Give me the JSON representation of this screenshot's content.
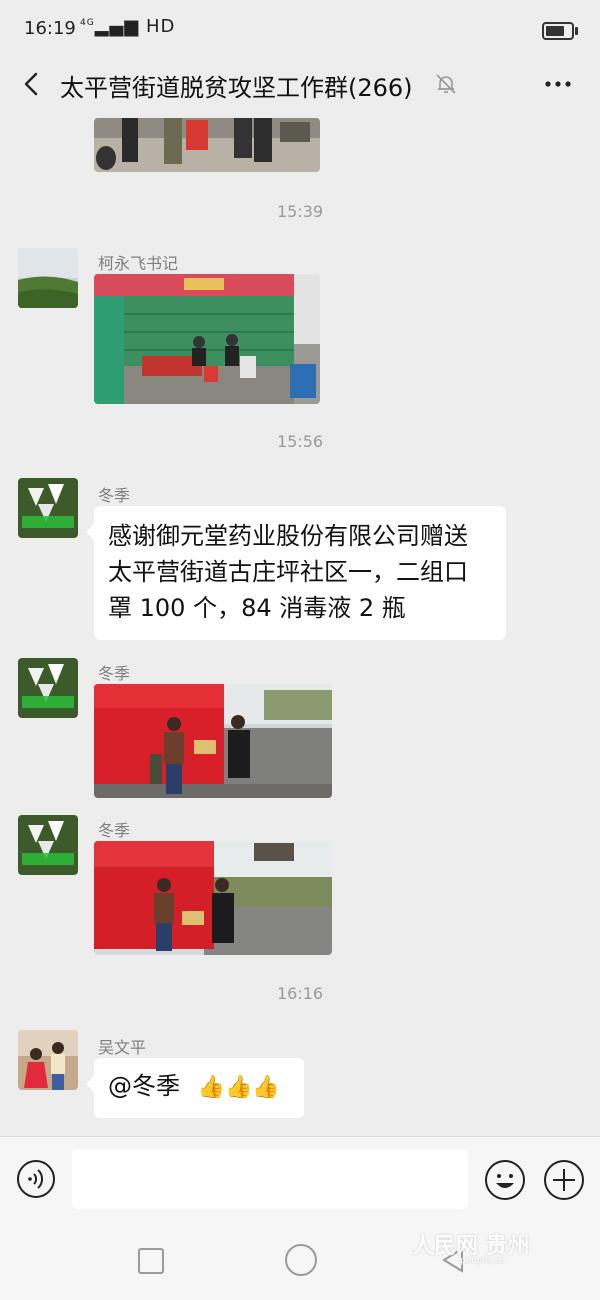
{
  "status_bar": {
    "time": "16:19",
    "network_small": "4G",
    "network": "HD",
    "battery_level": 0.75
  },
  "header": {
    "title": "太平营街道脱贫攻坚工作群(266)",
    "back_icon": "chevron-left-icon",
    "mute_icon": "bell-off-icon",
    "more_icon": "more-horizontal-icon"
  },
  "messages": {
    "time1": "15:39",
    "msg1": {
      "sender": "柯永飞书记",
      "type": "image"
    },
    "time2": "15:56",
    "msg2": {
      "sender": "冬季",
      "text": [
        "感谢御元堂药业股份有限公司赠送",
        "太平营街道古庄坪社区一，二组口",
        "罩 100 个，84 消毒液 2 瓶"
      ]
    },
    "msg3": {
      "sender": "冬季",
      "type": "image"
    },
    "msg4": {
      "sender": "冬季",
      "type": "image"
    },
    "time3": "16:16",
    "msg5": {
      "sender": "吴文平",
      "text": "@冬季",
      "emojis": "👍👍👍"
    }
  },
  "input_bar": {
    "placeholder": "",
    "voice_icon": "voice-icon",
    "emoji_icon": "smile-icon",
    "add_icon": "plus-circle-icon"
  },
  "nav_bar": {
    "recent_icon": "square-icon",
    "home_icon": "circle-icon",
    "back_icon": "triangle-back-icon"
  },
  "watermark": {
    "text": "人民网 贵州",
    "sub": "people.cn"
  }
}
